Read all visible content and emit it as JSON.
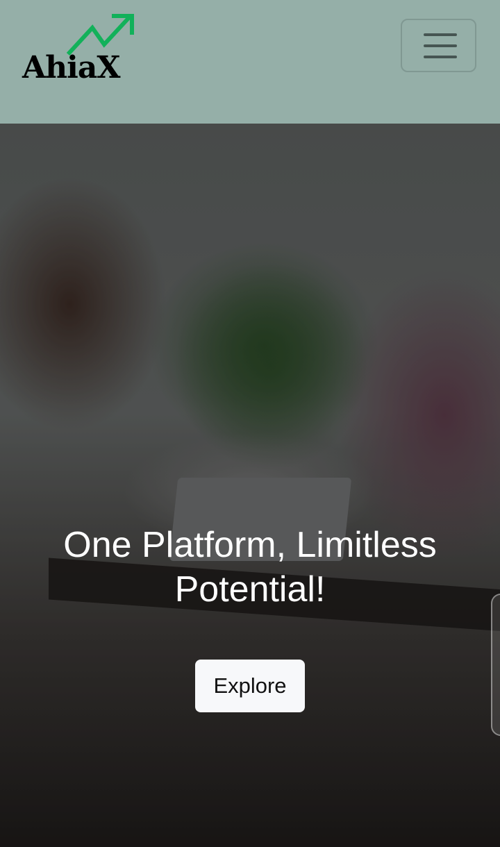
{
  "header": {
    "brand": "AhiaX",
    "brand_icon": "trending-up-arrow-icon",
    "brand_icon_color": "#12b15a",
    "menu_icon": "hamburger-menu-icon",
    "background": "#95afa8"
  },
  "hero": {
    "title": "One Platform, Limitless Potential!",
    "button_label": "Explore"
  }
}
